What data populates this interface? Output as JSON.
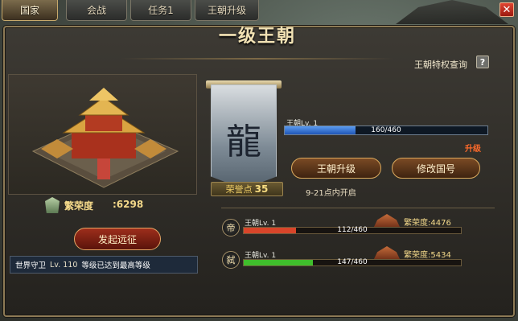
{
  "tabs": [
    {
      "label": "国家"
    },
    {
      "label": "会战"
    },
    {
      "label": "任务1"
    },
    {
      "label": "王朝升级"
    }
  ],
  "close_icon": "close-icon",
  "panel": {
    "title": "一级王朝",
    "privilege_link": "王朝特权查询",
    "help_label": "?"
  },
  "left": {
    "glory_label": "繁荣度",
    "glory_value": ":6298",
    "launch_button": "发起远征",
    "world_guard": {
      "name": "世界守卫",
      "level": "Lv. 110",
      "status": "等级已达到最高等级"
    }
  },
  "banner": {
    "character": "龍",
    "honor_label": "荣誉点",
    "honor_value": "35"
  },
  "dynasty": {
    "name": "王朝Lv. 1",
    "progress_text": "160/460",
    "progress": 0.35,
    "upgrade_tag": "升级",
    "upgrade_button": "王朝升级",
    "rename_button": "修改国号",
    "open_time": "9-21点内开启"
  },
  "rows": [
    {
      "badge": "帝",
      "name": "王朝Lv. 1",
      "progress_text": "112/460",
      "progress": 0.24,
      "color": "#d8452a",
      "glory_label": "繁荣度",
      "glory_value": ":4476"
    },
    {
      "badge": "弑",
      "name": "王朝Lv. 1",
      "progress_text": "147/460",
      "progress": 0.32,
      "color": "#3fbe2c",
      "glory_label": "繁荣度",
      "glory_value": ":5434"
    }
  ]
}
